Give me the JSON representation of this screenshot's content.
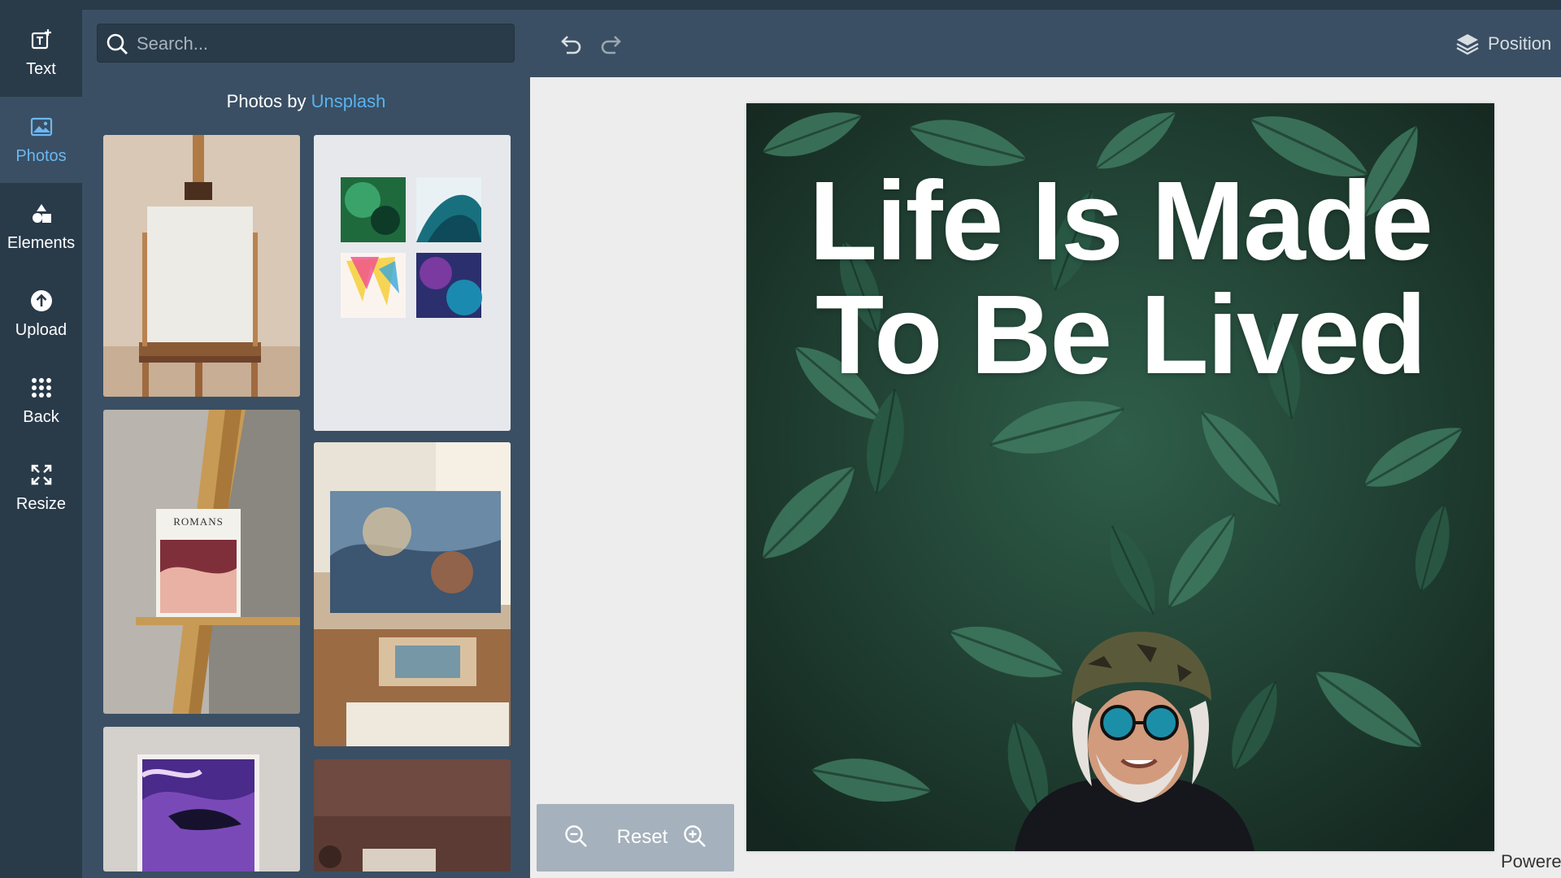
{
  "sidebar": {
    "items": [
      {
        "label": "Text",
        "icon": "text-add-icon"
      },
      {
        "label": "Photos",
        "icon": "image-icon",
        "active": true
      },
      {
        "label": "Elements",
        "icon": "shapes-icon"
      },
      {
        "label": "Upload",
        "icon": "upload-icon"
      },
      {
        "label": "Back",
        "icon": "grid-icon"
      },
      {
        "label": "Resize",
        "icon": "resize-icon"
      }
    ]
  },
  "photos_panel": {
    "search_placeholder": "Search...",
    "credit_prefix": "Photos by ",
    "credit_link": "Unsplash",
    "thumb_text_romans": "ROMANS"
  },
  "toolbar": {
    "position_label": "Position"
  },
  "canvas": {
    "headline_line1": "Life Is Made",
    "headline_line2": "To Be Lived"
  },
  "zoom": {
    "reset_label": "Reset"
  },
  "footer": {
    "powered_label": "Powere"
  },
  "colors": {
    "rail_bg": "#293a49",
    "panel_bg": "#3a4f63",
    "accent": "#58b3f2",
    "canvas_area": "#ededed"
  }
}
